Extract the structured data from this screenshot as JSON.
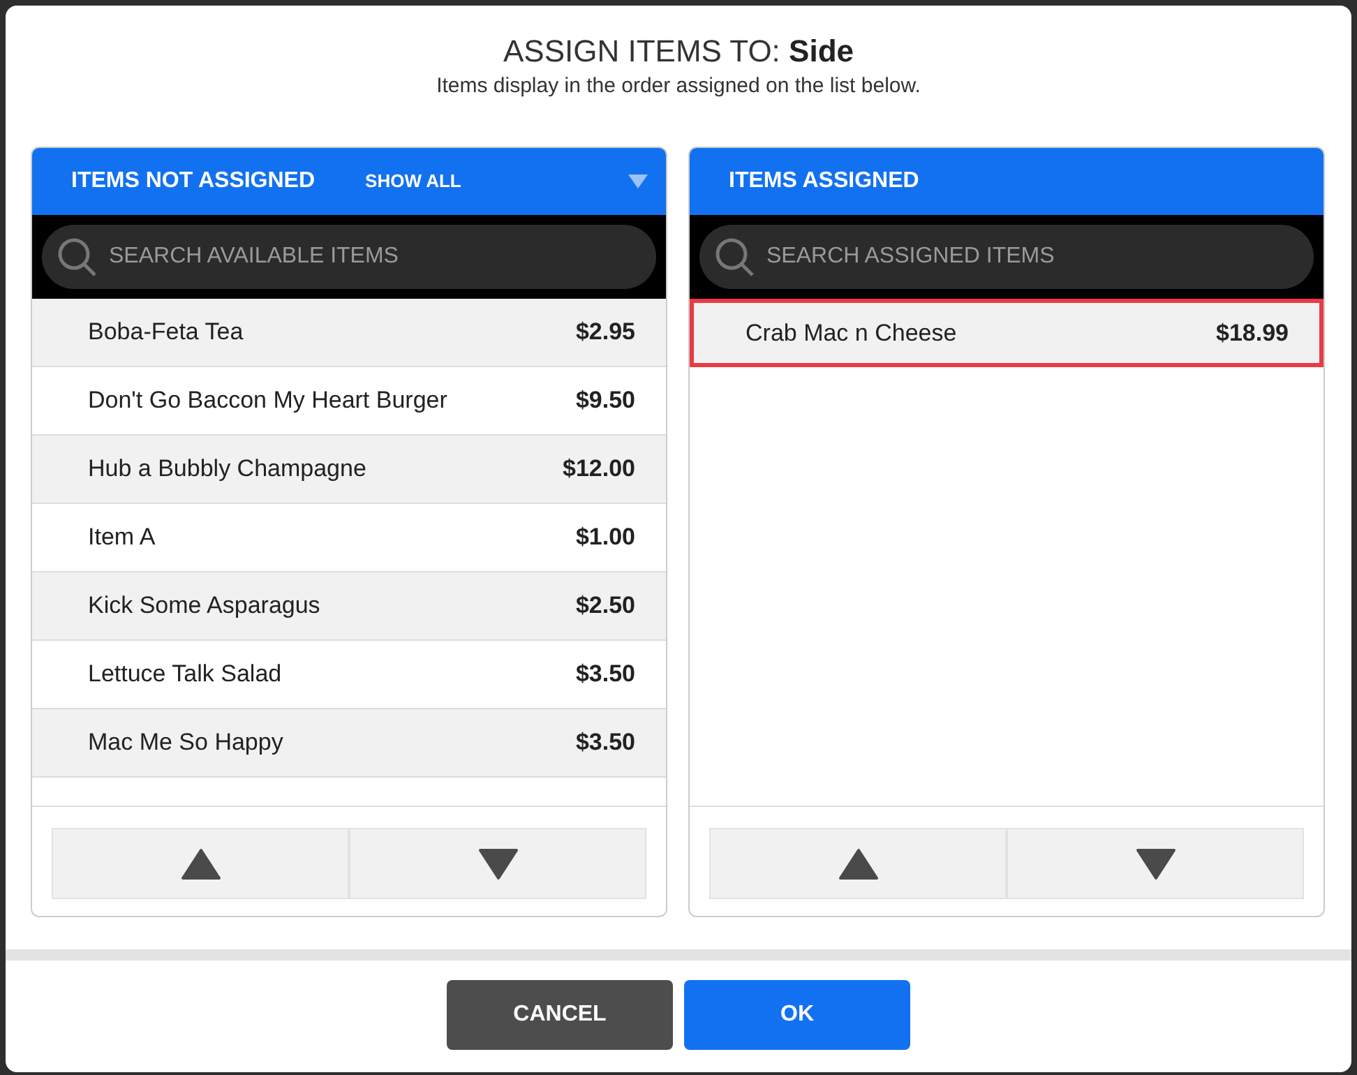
{
  "dialog": {
    "title": "ASSIGN ITEMS TO:",
    "target": "Side",
    "subtitle": "Items display in the order assigned on the list below."
  },
  "panels": [
    {
      "title": "ITEMS NOT ASSIGNED",
      "filter": "SHOW ALL",
      "search": {
        "placeholder": "SEARCH AVAILABLE ITEMS"
      },
      "items": [
        {
          "name": "Boba-Feta Tea",
          "price": "$2.95",
          "selected": false
        },
        {
          "name": "Don't Go Baccon My Heart Burger",
          "price": "$9.50",
          "selected": false
        },
        {
          "name": "Hub a Bubbly Champagne",
          "price": "$12.00",
          "selected": false
        },
        {
          "name": "Item A",
          "price": "$1.00",
          "selected": false
        },
        {
          "name": "Kick Some Asparagus",
          "price": "$2.50",
          "selected": false
        },
        {
          "name": "Lettuce Talk Salad",
          "price": "$3.50",
          "selected": false
        },
        {
          "name": "Mac Me So Happy",
          "price": "$3.50",
          "selected": false
        }
      ]
    },
    {
      "title": "ITEMS ASSIGNED",
      "search": {
        "placeholder": "SEARCH ASSIGNED ITEMS"
      },
      "items": [
        {
          "name": "Crab Mac n Cheese",
          "price": "$18.99",
          "selected": true
        }
      ]
    }
  ],
  "buttons": [
    {
      "label": "CANCEL",
      "kind": "secondary"
    },
    {
      "label": "OK",
      "kind": "primary"
    }
  ]
}
